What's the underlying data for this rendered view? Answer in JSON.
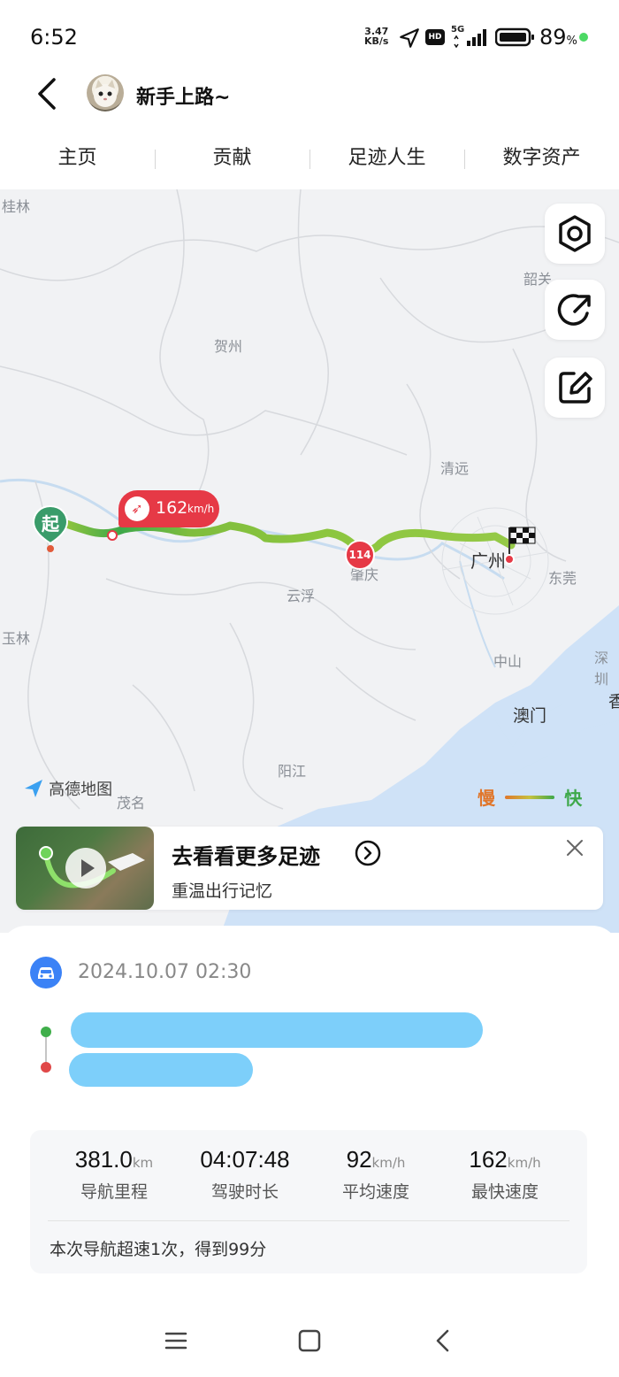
{
  "status_bar": {
    "time": "6:52",
    "net_speed_value": "3.47",
    "net_speed_unit": "KB/s",
    "hd_label": "HD",
    "network_label": "5G",
    "battery_percent": "89",
    "battery_percent_sign": "%"
  },
  "header": {
    "username": "新手上路~"
  },
  "tabs": [
    {
      "label": "主页"
    },
    {
      "label": "贡献"
    },
    {
      "label": "足迹人生"
    },
    {
      "label": "数字资产"
    }
  ],
  "map": {
    "cities": [
      "桂林",
      "韶关",
      "贺州",
      "清远",
      "云浮",
      "肇庆",
      "广州",
      "东莞",
      "玉林",
      "中山",
      "深圳",
      "澳门",
      "香",
      "阳江",
      "茂名"
    ],
    "start_marker": "起",
    "max_speed_badge": {
      "value": "162",
      "unit": "km/h"
    },
    "road_shield": "114",
    "brand": "高德地图",
    "legend": {
      "slow": "慢",
      "fast": "快"
    }
  },
  "promo": {
    "title": "去看看更多足迹",
    "subtitle": "重温出行记忆"
  },
  "trip": {
    "datetime": "2024.10.07 02:30",
    "stats": [
      {
        "value": "381.0",
        "unit": "km",
        "label": "导航里程"
      },
      {
        "value": "04:07:48",
        "unit": "",
        "label": "驾驶时长"
      },
      {
        "value": "92",
        "unit": "km/h",
        "label": "平均速度"
      },
      {
        "value": "162",
        "unit": "km/h",
        "label": "最快速度"
      }
    ],
    "summary": "本次导航超速1次，得到99分"
  },
  "colors": {
    "accent_blue": "#3b82f6",
    "route_green": "#8cc63f",
    "start_green": "#3a9c6a",
    "speed_red": "#e63946",
    "redaction_blue": "#7dcffa"
  }
}
